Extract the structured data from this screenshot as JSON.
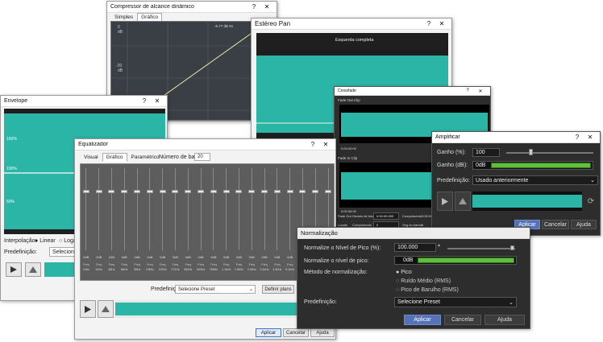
{
  "compressor": {
    "title": "Compressor de alcance dinâmico",
    "tabs": [
      "Simples",
      "Gráfico"
    ],
    "scale": [
      "0",
      "dB",
      "-20",
      "dB"
    ],
    "readout": "-6.77 dB IN"
  },
  "stereo": {
    "title": "Estéreo Pan",
    "label": "Esquerda completa"
  },
  "envelope": {
    "title": "Envelope",
    "levels": [
      "150%",
      "100%",
      "50%"
    ],
    "interp_label": "Interpolação:",
    "interp_linear": "Linear",
    "interp_log": "Logari",
    "preset_label": "Predefinição:",
    "preset_value": "Selecione Preset"
  },
  "equalizer": {
    "title": "Equalizador",
    "tabs": [
      "Visual",
      "Gráfico",
      "Paramétrico"
    ],
    "bands_label": "Número de bandas:",
    "bands_value": "20",
    "band_db": "0dB",
    "freq_label": "Freq",
    "freqs": [
      "24Hz",
      "34Hz",
      "48Hz",
      "68Hz",
      "96Hz",
      "136Hz",
      "192Hz",
      "272Hz",
      "384Hz",
      "543Hz",
      "768Hz",
      "1.1kHz",
      "1.5kHz",
      "2.2kHz",
      "3.1kHz",
      "4.4kHz",
      "6.1kHz",
      "8.7kHz",
      "12kHz",
      "17kHz"
    ],
    "preset_label": "Predefinição:",
    "preset_value": "Selecione Preset",
    "define_plans": "Definir plans",
    "apply": "Aplicar",
    "cancel": "Cancelar",
    "help": "Ajuda"
  },
  "crossfade": {
    "title": "Crossfade",
    "fade_out": "Fade Out Clip",
    "fade_in": "Fade In Clip",
    "time_a": "0:00:00:00",
    "time_b": "0:00:06:00",
    "row1": [
      "Fade Out",
      "Horário de início",
      "0:00:00.000",
      "Comprimento",
      "0:00:06"
    ],
    "row2": [
      "Locate",
      "Comprimento",
      "0",
      "Seg do bando",
      "0"
    ]
  },
  "amplify": {
    "title": "Amplificar",
    "gain_pct_label": "Ganho (%):",
    "gain_pct_value": "100",
    "gain_db_label": "Ganho (dB):",
    "gain_db_value": "0dB",
    "preset_label": "Predefinição:",
    "preset_value": "Usado anteriormente",
    "apply": "Aplicar",
    "cancel": "Cancelar",
    "help": "Ajuda"
  },
  "normalize": {
    "title": "Normalização",
    "peak_label": "Normalize o Nível de Pico (%):",
    "peak_value": "100.000",
    "peak_db_label": "Normalize o nível de pico:",
    "peak_db_value": "0dB",
    "method_label": "Método de normalização:",
    "methods": [
      "Pico",
      "Ruído Médio (RMS)",
      "Pico de Barulho (RMS)"
    ],
    "preset_label": "Predefinição:",
    "preset_value": "Selecione Preset",
    "apply": "Aplicar",
    "cancel": "Cancelar",
    "help": "Ajuda"
  },
  "colors": {
    "wave": "#2bb5a6",
    "dark_bg": "#2d2d2d",
    "meter": "#5fbf3a",
    "accent": "#5572b7"
  }
}
